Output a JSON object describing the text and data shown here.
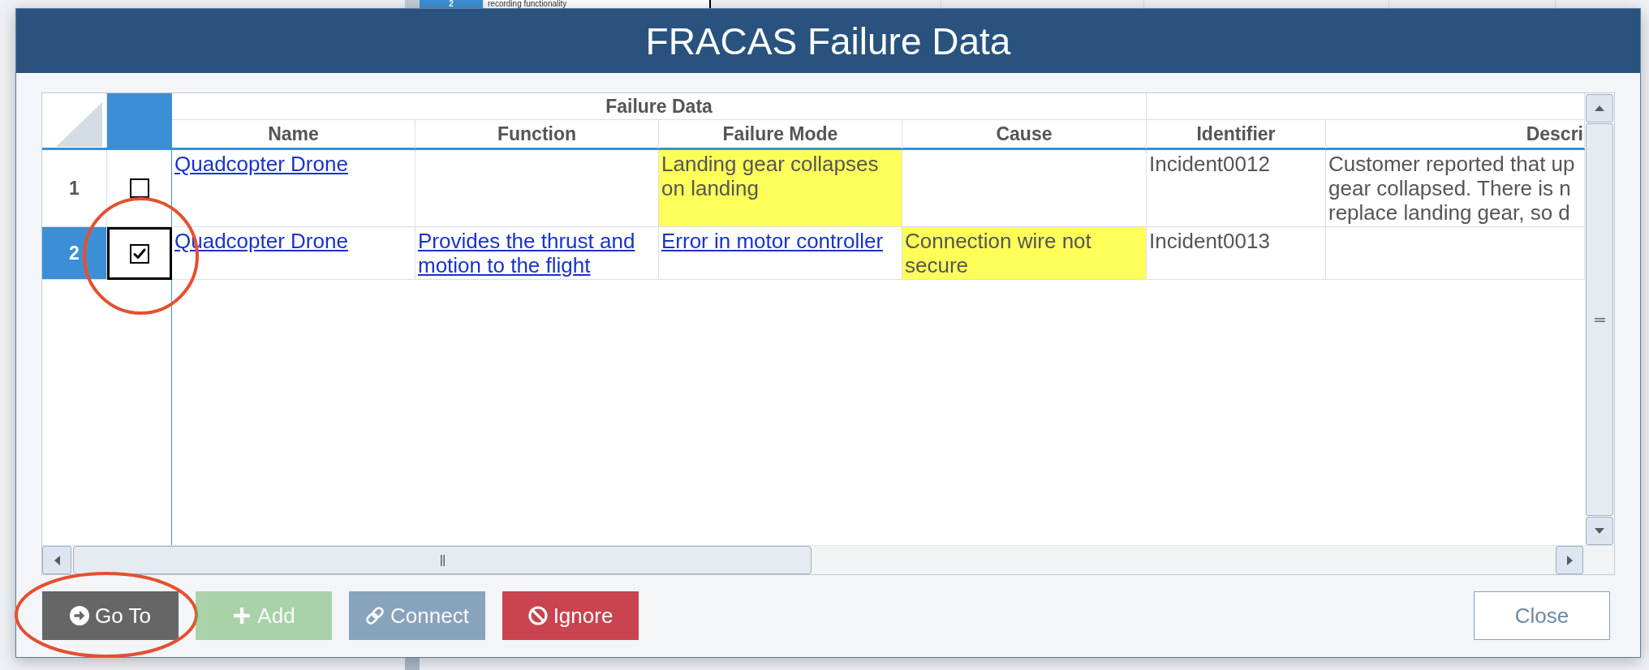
{
  "background_sheet": {
    "row_number": "2",
    "cell_text": "recording functionality"
  },
  "dialog": {
    "title": "FRACAS Failure Data"
  },
  "grid": {
    "column_groups": [
      {
        "label": "Failure Data",
        "columns": [
          {
            "label": "Name"
          },
          {
            "label": "Function"
          },
          {
            "label": "Failure Mode"
          },
          {
            "label": "Cause"
          }
        ]
      },
      {
        "columns": [
          {
            "label": "Identifier"
          },
          {
            "label": "Descri"
          }
        ]
      }
    ],
    "rows": [
      {
        "number": "1",
        "selected": false,
        "checked": false,
        "focused": false,
        "circled": false,
        "cells": [
          {
            "kind": "link",
            "text": "Quadcopter Drone",
            "highlighted": false
          },
          null,
          {
            "kind": "text",
            "text": "Landing gear collapses on landing",
            "highlighted": true
          },
          null,
          {
            "kind": "text",
            "text": "Incident0012",
            "highlighted": false
          },
          {
            "kind": "text",
            "lines": [
              "Customer reported that up",
              "gear collapsed. There is n",
              "replace landing gear, so d"
            ],
            "highlighted": false
          }
        ]
      },
      {
        "number": "2",
        "selected": true,
        "checked": true,
        "focused": true,
        "circled": true,
        "cells": [
          {
            "kind": "link",
            "text": "Quadcopter Drone",
            "highlighted": false
          },
          {
            "kind": "link",
            "text": "Provides the thrust and motion to the flight",
            "highlighted": false
          },
          {
            "kind": "link",
            "text": "Error in motor controller",
            "highlighted": false
          },
          {
            "kind": "text",
            "text": "Connection wire not secure",
            "highlighted": true
          },
          {
            "kind": "text",
            "text": "Incident0013",
            "highlighted": false
          },
          null
        ]
      }
    ]
  },
  "buttons": [
    {
      "kind": "go_to",
      "label": "Go To",
      "disabled": false,
      "circled": true
    },
    {
      "kind": "add",
      "label": "Add",
      "disabled": true,
      "circled": false
    },
    {
      "kind": "connect",
      "label": "Connect",
      "disabled": true,
      "circled": false
    },
    {
      "kind": "ignore",
      "label": "Ignore",
      "disabled": false,
      "circled": false
    },
    {
      "kind": "close",
      "label": "Close",
      "disabled": false,
      "circled": false
    }
  ]
}
